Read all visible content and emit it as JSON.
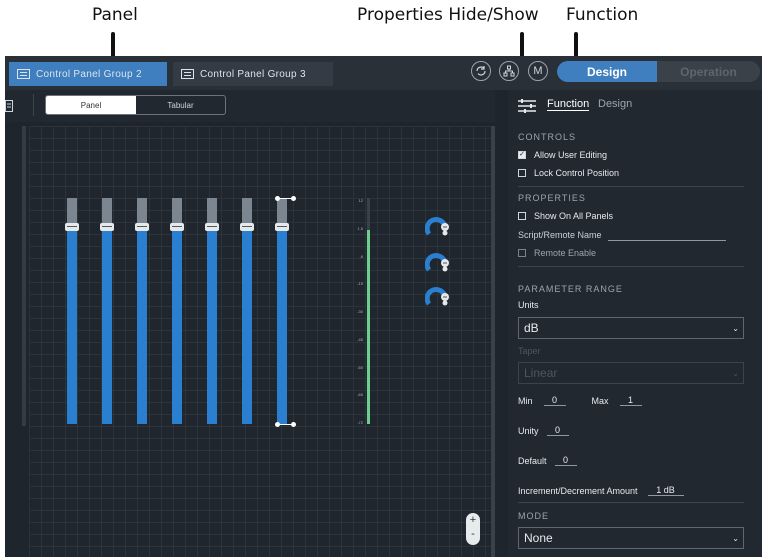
{
  "callouts": {
    "panel": "Panel",
    "props_toggle": "Properties Hide/Show",
    "function": "Function"
  },
  "tabs": [
    {
      "label": "Control Panel Group 2"
    },
    {
      "label": "Control Panel Group 3"
    }
  ],
  "header": {
    "m_label": "M",
    "sync_icon": "sync-icon",
    "network_icon": "network-icon"
  },
  "mode": {
    "design": "Design",
    "operation": "Operation",
    "accent": "#3f7fc0"
  },
  "toolbar": {
    "panel": "Panel",
    "tabular": "Tabular"
  },
  "meter_labels": [
    "12",
    "1.5",
    "-9",
    "-15",
    "-30",
    "-45",
    "-60",
    "-65",
    "-72"
  ],
  "fader_levels": [
    0.87,
    0.87,
    0.87,
    0.87,
    0.87,
    0.87,
    0.87
  ],
  "properties": {
    "tab_function": "Function",
    "tab_design": "Design",
    "controls_title": "CONTROLS",
    "allow_user_editing": "Allow User Editing",
    "lock_control_position": "Lock Control Position",
    "properties_title": "PROPERTIES",
    "show_on_all_panels": "Show On All Panels",
    "script_remote_name": "Script/Remote Name",
    "remote_enable": "Remote Enable",
    "param_range_title": "PARAMETER RANGE",
    "units_label": "Units",
    "units_value": "dB",
    "taper_label": "Taper",
    "taper_value": "Linear",
    "min_label": "Min",
    "min_value": "0",
    "max_label": "Max",
    "max_value": "1",
    "unity_label": "Unity",
    "unity_value": "0",
    "default_label": "Default",
    "default_value": "0",
    "incdec_label": "Increment/Decrement Amount",
    "incdec_value": "1 dB",
    "mode_title": "MODE",
    "mode_value": "None"
  },
  "zoom": {
    "plus": "+",
    "minus": "-"
  }
}
